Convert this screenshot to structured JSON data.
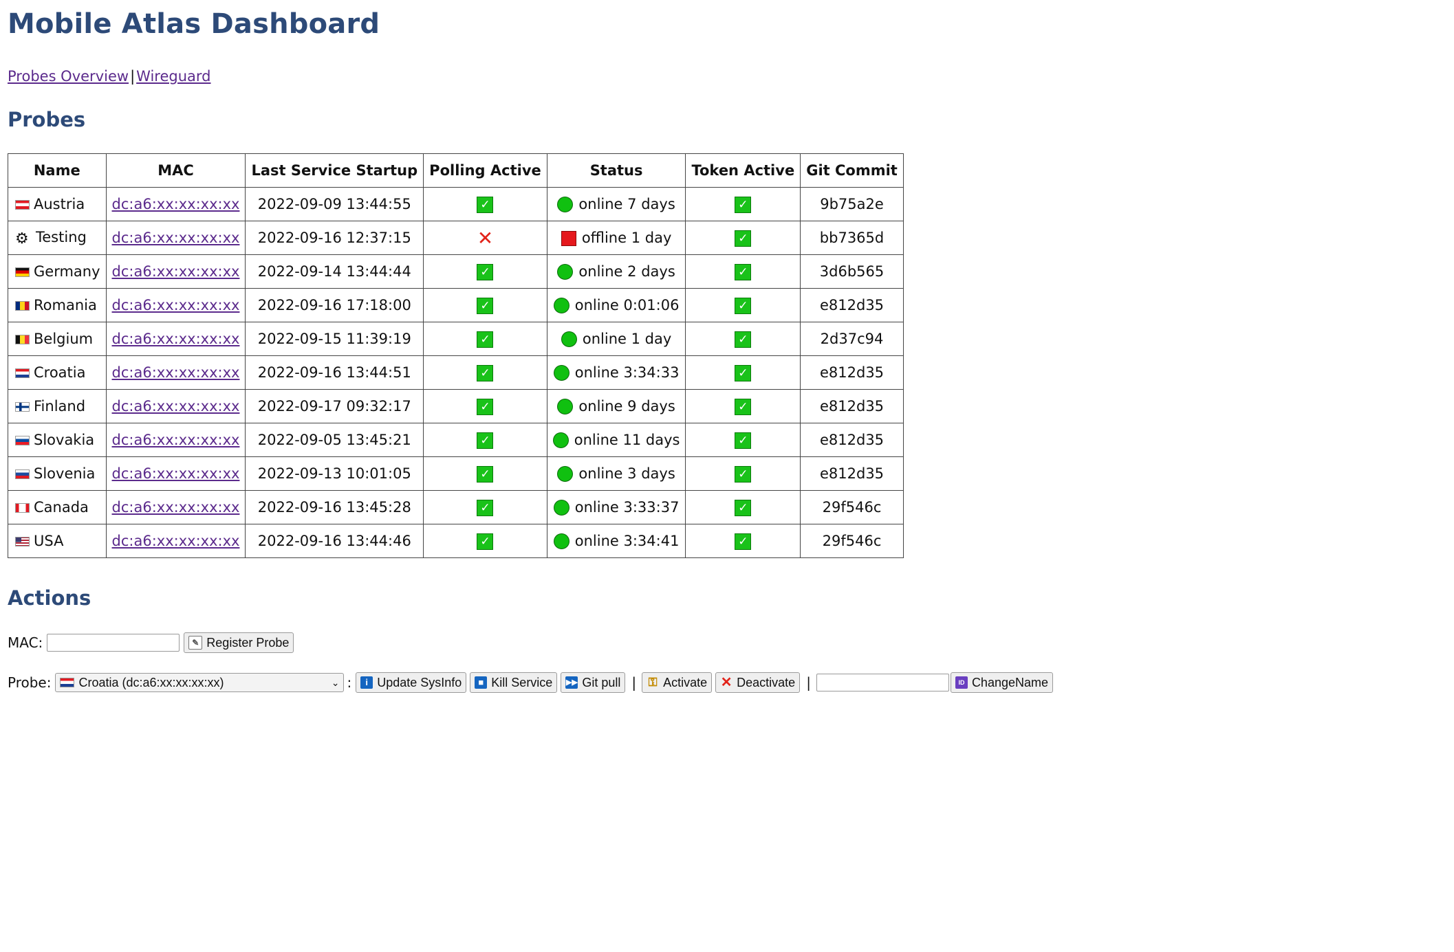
{
  "title": "Mobile Atlas Dashboard",
  "nav": {
    "overview": "Probes Overview",
    "separator": "|",
    "wireguard": "Wireguard"
  },
  "probes_heading": "Probes",
  "table": {
    "headers": [
      "Name",
      "MAC",
      "Last Service Startup",
      "Polling Active",
      "Status",
      "Token Active",
      "Git Commit"
    ],
    "rows": [
      {
        "name": "Austria",
        "flag": "austria-flag",
        "mac": "dc:a6:xx:xx:xx:xx",
        "startup": "2022-09-09 13:44:55",
        "polling": "check-icon",
        "status_icon": "online-dot",
        "status": "online 7 days",
        "token": "check-icon",
        "commit": "9b75a2e"
      },
      {
        "name": "Testing",
        "flag": "gear-icon",
        "mac": "dc:a6:xx:xx:xx:xx",
        "startup": "2022-09-16 12:37:15",
        "polling": "cross-icon",
        "status_icon": "offline-square",
        "status": "offline 1 day",
        "token": "check-icon",
        "commit": "bb7365d"
      },
      {
        "name": "Germany",
        "flag": "germany-flag",
        "mac": "dc:a6:xx:xx:xx:xx",
        "startup": "2022-09-14 13:44:44",
        "polling": "check-icon",
        "status_icon": "online-dot",
        "status": "online 2 days",
        "token": "check-icon",
        "commit": "3d6b565"
      },
      {
        "name": "Romania",
        "flag": "romania-flag",
        "mac": "dc:a6:xx:xx:xx:xx",
        "startup": "2022-09-16 17:18:00",
        "polling": "check-icon",
        "status_icon": "online-dot",
        "status": "online 0:01:06",
        "token": "check-icon",
        "commit": "e812d35"
      },
      {
        "name": "Belgium",
        "flag": "belgium-flag",
        "mac": "dc:a6:xx:xx:xx:xx",
        "startup": "2022-09-15 11:39:19",
        "polling": "check-icon",
        "status_icon": "online-dot",
        "status": "online 1 day",
        "token": "check-icon",
        "commit": "2d37c94"
      },
      {
        "name": "Croatia",
        "flag": "croatia-flag",
        "mac": "dc:a6:xx:xx:xx:xx",
        "startup": "2022-09-16 13:44:51",
        "polling": "check-icon",
        "status_icon": "online-dot",
        "status": "online 3:34:33",
        "token": "check-icon",
        "commit": "e812d35"
      },
      {
        "name": "Finland",
        "flag": "finland-flag",
        "mac": "dc:a6:xx:xx:xx:xx",
        "startup": "2022-09-17 09:32:17",
        "polling": "check-icon",
        "status_icon": "online-dot",
        "status": "online 9 days",
        "token": "check-icon",
        "commit": "e812d35"
      },
      {
        "name": "Slovakia",
        "flag": "slovakia-flag",
        "mac": "dc:a6:xx:xx:xx:xx",
        "startup": "2022-09-05 13:45:21",
        "polling": "check-icon",
        "status_icon": "online-dot",
        "status": "online 11 days",
        "token": "check-icon",
        "commit": "e812d35"
      },
      {
        "name": "Slovenia",
        "flag": "slovenia-flag",
        "mac": "dc:a6:xx:xx:xx:xx",
        "startup": "2022-09-13 10:01:05",
        "polling": "check-icon",
        "status_icon": "online-dot",
        "status": "online 3 days",
        "token": "check-icon",
        "commit": "e812d35"
      },
      {
        "name": "Canada",
        "flag": "canada-flag",
        "mac": "dc:a6:xx:xx:xx:xx",
        "startup": "2022-09-16 13:45:28",
        "polling": "check-icon",
        "status_icon": "online-dot",
        "status": "online 3:33:37",
        "token": "check-icon",
        "commit": "29f546c"
      },
      {
        "name": "USA",
        "flag": "usa-flag",
        "mac": "dc:a6:xx:xx:xx:xx",
        "startup": "2022-09-16 13:44:46",
        "polling": "check-icon",
        "status_icon": "online-dot",
        "status": "online 3:34:41",
        "token": "check-icon",
        "commit": "29f546c"
      }
    ]
  },
  "actions_heading": "Actions",
  "actions": {
    "mac_label": "MAC:",
    "mac_value": "",
    "register_button": "Register Probe",
    "probe_label": "Probe:",
    "probe_selected": "Croatia (dc:a6:xx:xx:xx:xx)",
    "colon": ":",
    "update_sysinfo_button": "Update SysInfo",
    "kill_service_button": "Kill Service",
    "git_pull_button": "Git pull",
    "pipe": "|",
    "activate_button": "Activate",
    "deactivate_button": "Deactivate",
    "new_name_value": "",
    "change_name_button": "ChangeName"
  },
  "colors": {
    "heading": "#2d4a78",
    "link": "#5b2a8c",
    "online": "#10c010",
    "offline": "#e5181d",
    "check": "#19c219",
    "cross": "#e2231a"
  }
}
